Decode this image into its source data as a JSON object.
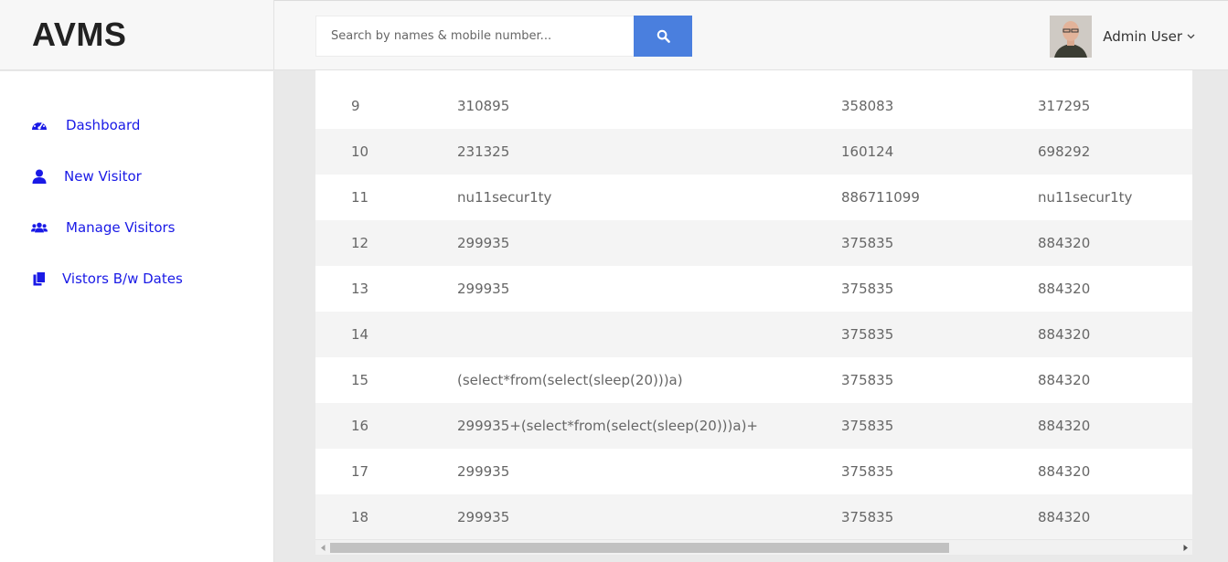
{
  "brand": {
    "title": "AVMS"
  },
  "search": {
    "placeholder": "Search by names & mobile number..."
  },
  "user": {
    "name": "Admin User"
  },
  "sidebar": {
    "items": [
      {
        "label": "Dashboard",
        "icon": "dashboard-icon"
      },
      {
        "label": "New Visitor",
        "icon": "user-icon"
      },
      {
        "label": "Manage Visitors",
        "icon": "users-icon"
      },
      {
        "label": "Vistors B/w Dates",
        "icon": "copy-icon"
      }
    ]
  },
  "table": {
    "rows": [
      {
        "id": "9",
        "name": "310895",
        "col3": "358083",
        "col4": "317295"
      },
      {
        "id": "10",
        "name": "231325",
        "col3": "160124",
        "col4": "698292"
      },
      {
        "id": "11",
        "name": "nu11secur1ty",
        "col3": "886711099",
        "col4": "nu11secur1ty"
      },
      {
        "id": "12",
        "name": "299935",
        "col3": "375835",
        "col4": "884320"
      },
      {
        "id": "13",
        "name": "299935",
        "col3": "375835",
        "col4": "884320"
      },
      {
        "id": "14",
        "name": "",
        "col3": "375835",
        "col4": "884320"
      },
      {
        "id": "15",
        "name": "(select*from(select(sleep(20)))a)",
        "col3": "375835",
        "col4": "884320"
      },
      {
        "id": "16",
        "name": "299935+(select*from(select(sleep(20)))a)+",
        "col3": "375835",
        "col4": "884320"
      },
      {
        "id": "17",
        "name": "299935",
        "col3": "375835",
        "col4": "884320"
      },
      {
        "id": "18",
        "name": "299935",
        "col3": "375835",
        "col4": "884320"
      }
    ]
  },
  "colors": {
    "accent": "#4a7fde",
    "nav_link": "#1a1ae6",
    "row_alt": "#f4f4f4"
  }
}
